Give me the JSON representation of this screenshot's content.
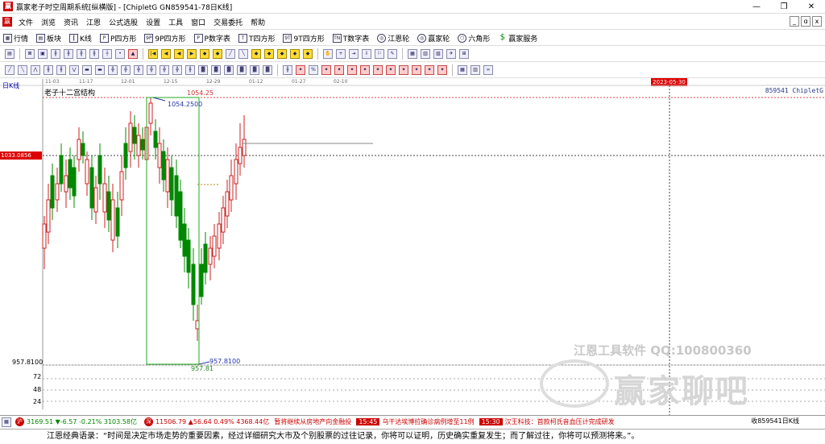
{
  "window": {
    "title": "赢家老子时空周期系统[纵横版] - [ChipletG  GN859541-78日K线]",
    "controls": [
      "—",
      "❐",
      "✕"
    ]
  },
  "menu": {
    "items": [
      "文件",
      "浏览",
      "资讯",
      "江恩",
      "公式选股",
      "设置",
      "工具",
      "窗口",
      "交易委托",
      "帮助"
    ],
    "right": [
      "_",
      "ɑ",
      "x"
    ]
  },
  "toolbar1": [
    {
      "label": "行情",
      "icon": "grid-icon"
    },
    {
      "label": "板块",
      "icon": "blocks-icon"
    },
    {
      "label": "K线",
      "icon": "candle-icon"
    },
    {
      "label": "P四方形",
      "icon": "p-icon",
      "iconText": "P四"
    },
    {
      "label": "9P四方形",
      "icon": "9p-icon",
      "iconText": "9P"
    },
    {
      "label": "P数字表",
      "icon": "p-table-icon",
      "iconText": "P"
    },
    {
      "label": "T四方形",
      "icon": "t-icon",
      "iconText": "T"
    },
    {
      "label": "9T四方形",
      "icon": "9t-icon",
      "iconText": "9T"
    },
    {
      "label": "T数字表",
      "icon": "t-table-icon",
      "iconText": "TN"
    },
    {
      "label": "江恩轮",
      "icon": "gann-wheel-icon",
      "iconText": "◎"
    },
    {
      "label": "赢家轮",
      "icon": "winner-wheel-icon",
      "iconText": "◎"
    },
    {
      "label": "六角形",
      "icon": "hexagon-icon",
      "iconText": "⬡"
    },
    {
      "label": "赢家服务",
      "icon": "dollar-icon",
      "iconText": "$"
    }
  ],
  "chart": {
    "period_label": "日K线",
    "cycle_title": "老子十二宫结构",
    "code_right": "859541 ChipletG",
    "date_badge": "2023-05-30",
    "price_tag": "1033.0856",
    "date_ticks": [
      "11-03",
      "11-17",
      "12-01",
      "12-15",
      "12-29",
      "01-12",
      "01-27",
      "02-10"
    ],
    "high_label_red": "1054.25",
    "high_label_blue": "1054.2500",
    "low_label_blue": "957.8100",
    "low_label_green": "957.81",
    "axis_low": "957.8100",
    "vol_ticks": [
      "72",
      "48",
      "24"
    ]
  },
  "chart_data": {
    "type": "candlestick",
    "title": "",
    "high": 1054.25,
    "low": 957.81,
    "ylim": [
      957.81,
      1054.25
    ]
  },
  "watermark": {
    "line1": "江恩工具软件  QQ:100800360",
    "line2": "赢家聊吧"
  },
  "ticker": {
    "idx1_badge": "沪",
    "idx1": "3169.51 ▼-6.57 -0.21% 3103.58亿",
    "idx2_badge": "深",
    "idx2": "11506.79 ▲56.64 0.49% 4368.44亿",
    "news": [
      {
        "time": "",
        "text": "暂将继续从房地产向金融投"
      },
      {
        "time": "15:45",
        "text": "乌干达埃博拉确诊病例增至11例"
      },
      {
        "time": "15:30",
        "text": "汉王科技：首款柯氏音血压计完成研发"
      }
    ],
    "right": "收859541日K线"
  },
  "quote": "江恩经典语录：“时间是决定市场走势的重要因素，经过详细研究大市及个别股票的过往记录，你将可以证明，历史确实重复发生；而了解过往，你将可以预测将来。”。",
  "colors": {
    "up": "#cc2222",
    "down": "#008800",
    "box": "#22aa22",
    "blue_label": "#2233aa"
  }
}
